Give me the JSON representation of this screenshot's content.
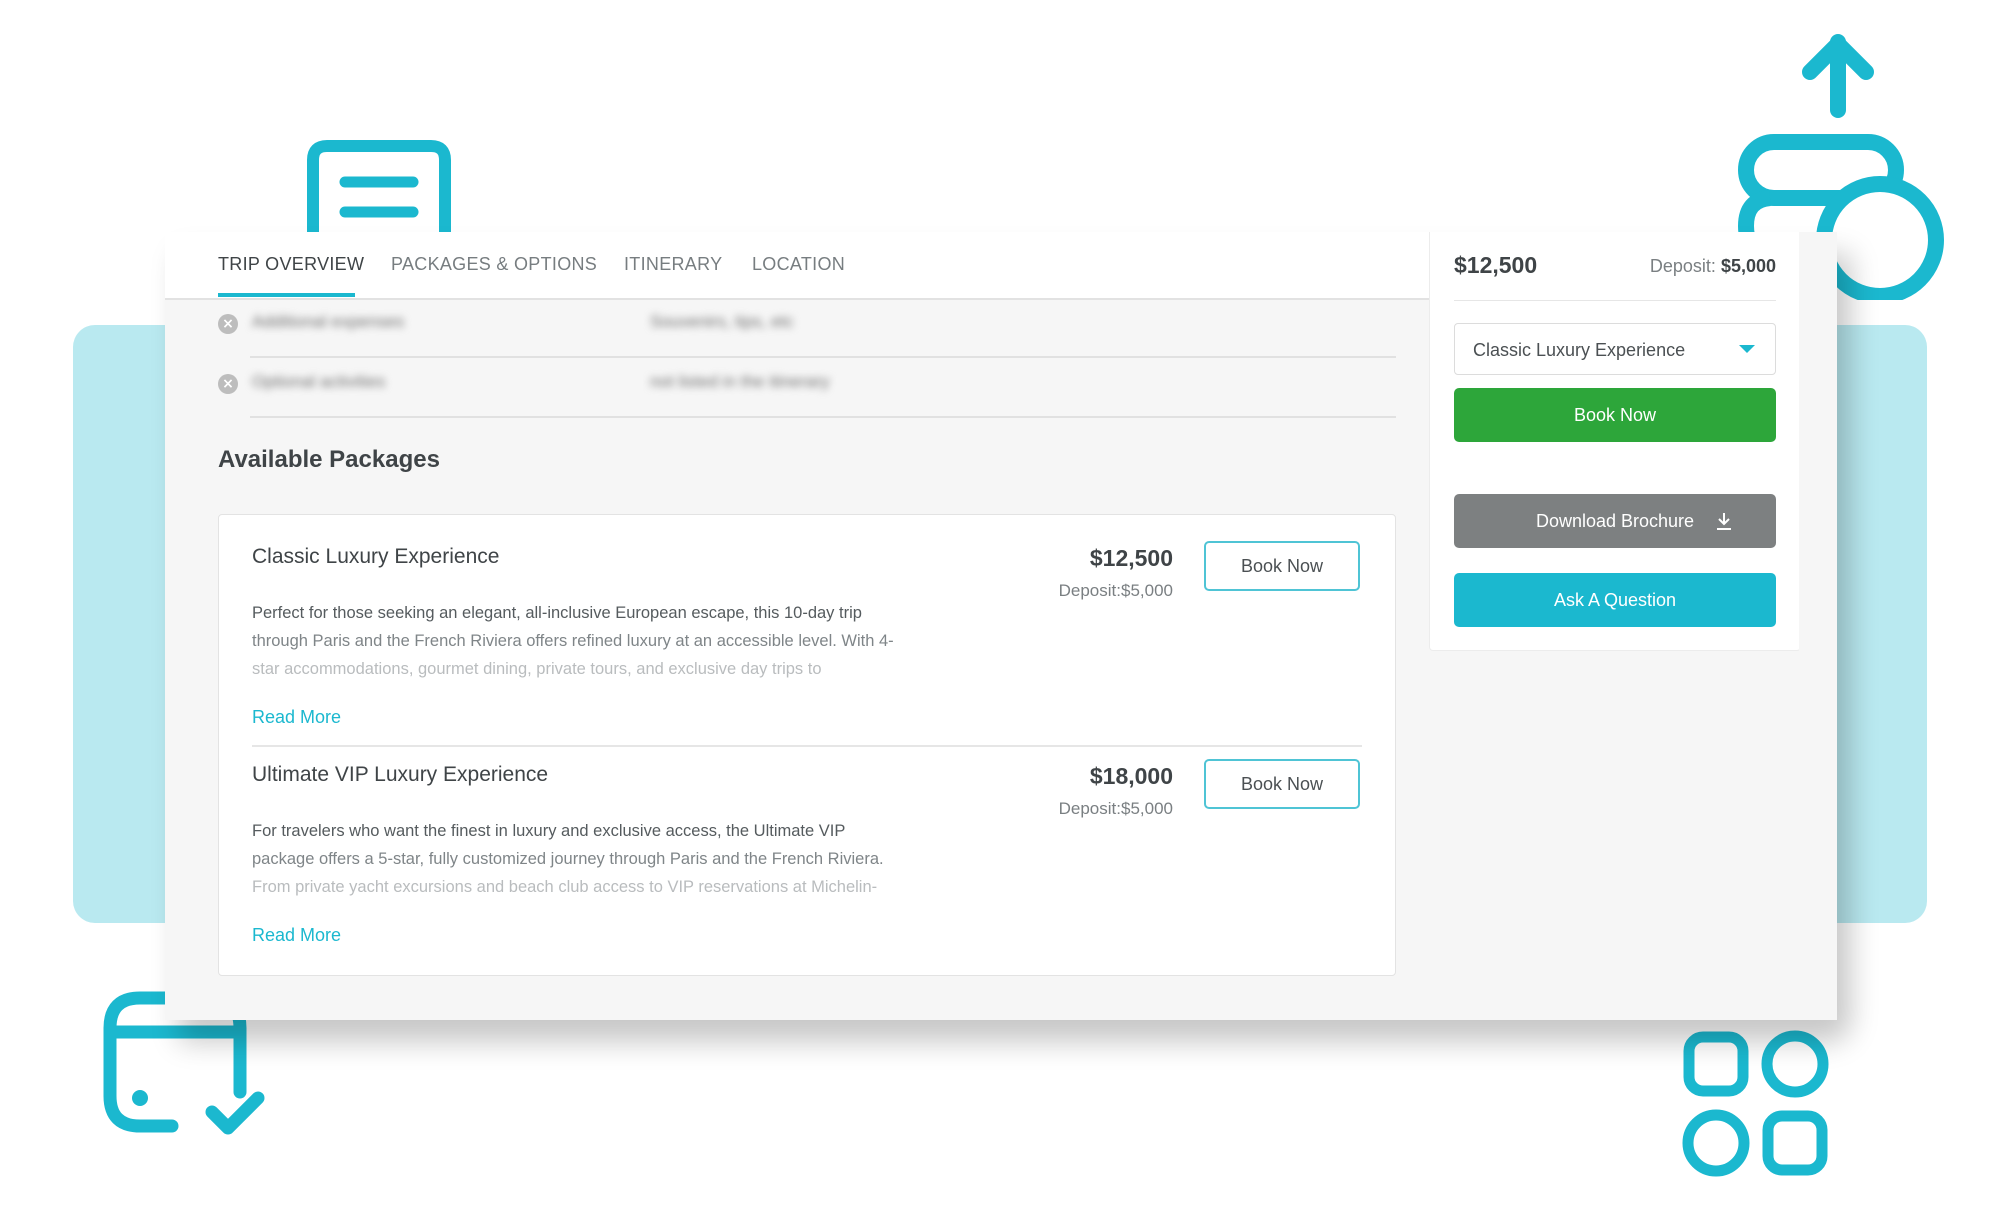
{
  "tabs": [
    {
      "label": "TRIP OVERVIEW",
      "active": true
    },
    {
      "label": "PACKAGES & OPTIONS",
      "active": false
    },
    {
      "label": "ITINERARY",
      "active": false
    },
    {
      "label": "LOCATION",
      "active": false
    }
  ],
  "exclusions": [
    {
      "icon": "x-circle-icon",
      "label": "Additional expenses",
      "value": "Souvenirs, tips, etc"
    },
    {
      "icon": "x-circle-icon",
      "label": "Optional activities",
      "value": "not listed in the itinerary"
    }
  ],
  "packages_section": {
    "title": "Available Packages",
    "packages": [
      {
        "name": "Classic Luxury Experience",
        "price": "$12,500",
        "deposit": "Deposit:$5,000",
        "book_label": "Book Now",
        "description_lines": [
          "Perfect for those seeking an elegant, all-inclusive European escape, this 10-day trip",
          "through Paris and the French Riviera offers refined luxury at an accessible level. With 4-",
          "star accommodations, gourmet dining, private tours, and exclusive day trips to"
        ],
        "read_more": "Read More"
      },
      {
        "name": "Ultimate VIP Luxury Experience",
        "price": "$18,000",
        "deposit": "Deposit:$5,000",
        "book_label": "Book Now",
        "description_lines": [
          "For travelers who want the finest in luxury and exclusive access, the Ultimate VIP",
          "package offers a 5-star, fully customized journey through Paris and the French Riviera.",
          "From private yacht excursions and beach club access to VIP reservations at Michelin-"
        ],
        "read_more": "Read More"
      }
    ]
  },
  "sidebar": {
    "price": "$12,500",
    "deposit_label": "Deposit:",
    "deposit_value": "$5,000",
    "selected_package": "Classic Luxury Experience",
    "book_now": "Book Now",
    "download_brochure": "Download Brochure",
    "ask_question": "Ask A Question"
  },
  "decorations": {
    "accent_color": "#1bb8cf",
    "icons": [
      "document-icon",
      "coins-upload-icon",
      "card-check-icon",
      "apps-grid-icon"
    ]
  },
  "colors": {
    "accent": "#1bb8cf",
    "book_green": "#2da63a",
    "brochure_gray": "#7d8081",
    "band": "#b9e9f0"
  }
}
